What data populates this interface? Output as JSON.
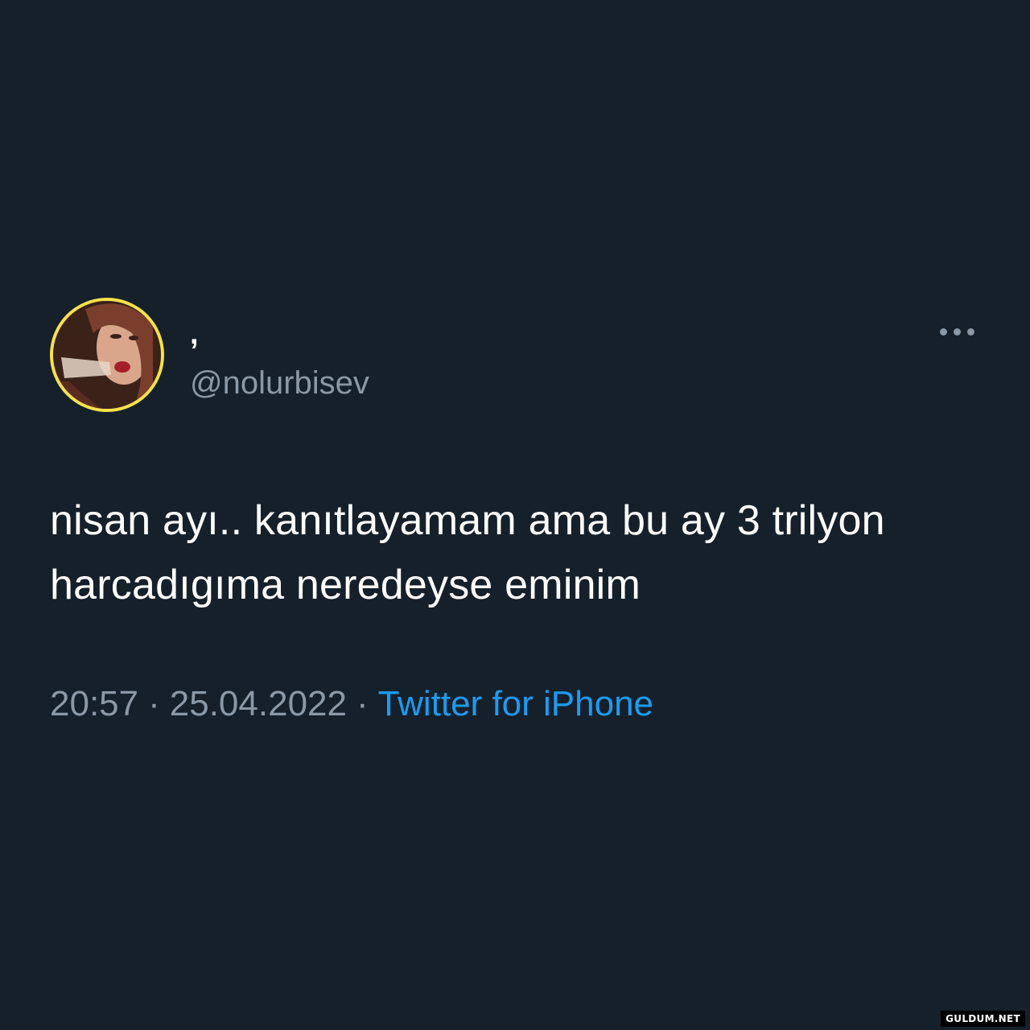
{
  "tweet": {
    "display_name": ",",
    "handle": "@nolurbisev",
    "text": "nisan ayı.. kanıtlayamam ama bu ay 3 trilyon harcadıgıma neredeyse eminim",
    "time": "20:57",
    "separator": "·",
    "date": "25.04.2022",
    "source": "Twitter for iPhone",
    "more_icon": "more-horizontal-icon"
  },
  "watermark": "GULDUM.NET",
  "colors": {
    "background": "#15202b",
    "primary_text": "#ffffff",
    "secondary_text": "#8b98a5",
    "accent": "#1d9bf0",
    "avatar_border": "#f6e24a"
  }
}
